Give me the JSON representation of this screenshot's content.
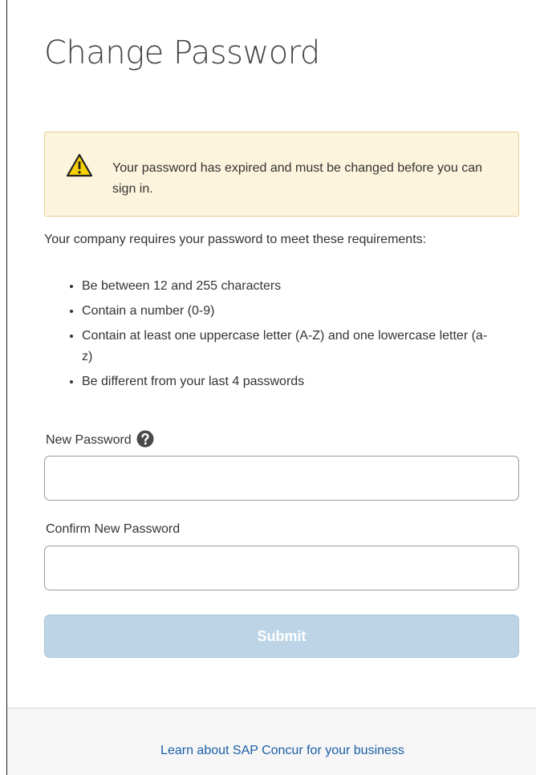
{
  "page": {
    "title": "Change Password"
  },
  "alert": {
    "icon": "warning-icon",
    "message": "Your password has expired and must be changed before you can sign in."
  },
  "requirements": {
    "intro": "Your company requires your password to meet these requirements:",
    "items": [
      "Be between 12 and 255 characters",
      "Contain a number (0-9)",
      "Contain at least one uppercase letter (A-Z) and one lowercase letter (a-z)",
      "Be different from your last 4 passwords"
    ]
  },
  "form": {
    "new_password_label": "New Password",
    "new_password_value": "",
    "help_icon": "question-circle-icon",
    "confirm_password_label": "Confirm New Password",
    "confirm_password_value": "",
    "submit_label": "Submit"
  },
  "footer": {
    "link_text": "Learn about SAP Concur for your business"
  },
  "colors": {
    "alert_background": "#fcf4dc",
    "alert_border": "#e9cf92",
    "submit_disabled": "#bcd4e6",
    "link": "#1b5fa7",
    "warning": "#f5d000"
  }
}
